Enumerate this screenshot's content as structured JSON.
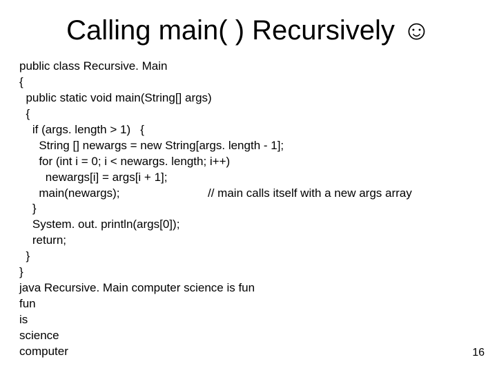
{
  "title": "Calling main( ) Recursively ",
  "title_icon": "☺",
  "code_lines": [
    "public class Recursive. Main",
    "{",
    "  public static void main(String[] args)",
    "  {",
    "    if (args. length > 1)   {",
    "      String [] newargs = new String[args. length - 1];",
    "      for (int i = 0; i < newargs. length; i++)",
    "        newargs[i] = args[i + 1];",
    "      main(newargs);                           // main calls itself with a new args array",
    "    }",
    "    System. out. println(args[0]);",
    "    return;",
    "  }",
    "}",
    "java Recursive. Main computer science is fun",
    "fun",
    "is",
    "science",
    "computer"
  ],
  "page_number": "16"
}
